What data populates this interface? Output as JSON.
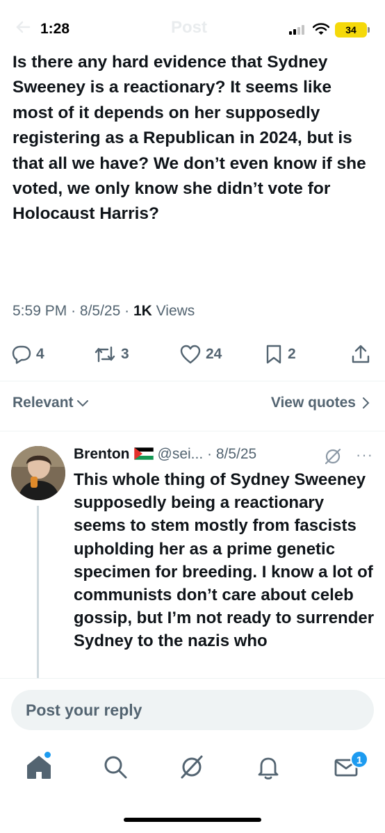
{
  "status_bar": {
    "time": "1:28",
    "background_title": "Post",
    "battery": "34"
  },
  "tweet": {
    "text": "Is there any hard evidence that Sydney Sweeney is a reactionary? It seems like most of it depends on her supposedly registering as a Republican in 2024, but is that all we have? We don’t even know if she voted, we only know she didn’t vote for Holocaust Harris?",
    "time": "5:59 PM",
    "date": "8/5/25",
    "views_count": "1K",
    "views_label": "Views",
    "replies": "4",
    "reposts": "3",
    "likes": "24",
    "bookmarks": "2"
  },
  "filters": {
    "sort_label": "Relevant",
    "view_quotes_label": "View quotes"
  },
  "reply": {
    "name": "Brenton",
    "handle": "@sei...",
    "date": "· 8/5/25",
    "more": "···",
    "text": "This whole thing of Sydney Sweeney supposedly being a reactionary seems to stem mostly from fascists upholding her as a prime genetic specimen for breeding. I know a lot of communists don’t care about celeb gossip, but I’m not ready to surrender Sydney to the nazis who"
  },
  "reply_bar": {
    "placeholder": "Post your reply"
  },
  "tab_bar": {
    "items": [
      "home",
      "search",
      "grok",
      "notifications",
      "messages"
    ],
    "messages_badge": "1"
  },
  "colors": {
    "accent": "#1d9bf0",
    "text_primary": "#0f1419",
    "text_secondary": "#536471",
    "battery": "#f5d90a"
  }
}
